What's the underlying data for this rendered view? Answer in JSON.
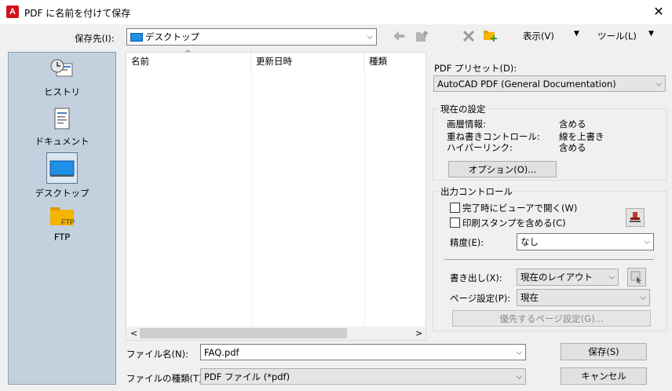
{
  "window": {
    "title": "PDF に名前を付けて保存",
    "app_icon_letter": "A"
  },
  "toolbar": {
    "save_in_label": "保存先(I):",
    "save_in_value": "デスクトップ",
    "view_menu": "表示(V)",
    "tools_menu": "ツール(L)"
  },
  "places": [
    {
      "label": "ヒストリ",
      "icon": "history-icon"
    },
    {
      "label": "ドキュメント",
      "icon": "documents-icon"
    },
    {
      "label": "デスクトップ",
      "icon": "desktop-icon"
    },
    {
      "label": "FTP",
      "icon": "ftp-folder-icon",
      "icon_text": "FTP"
    }
  ],
  "file_list": {
    "columns": [
      "名前",
      "更新日時",
      "種類"
    ]
  },
  "filename": {
    "label": "ファイル名(N):",
    "value": "FAQ.pdf"
  },
  "filetype": {
    "label": "ファイルの種類(T):",
    "value": "PDF ファイル (*pdf)"
  },
  "buttons": {
    "save": "保存(S)",
    "cancel": "キャンセル"
  },
  "pdf_preset": {
    "label": "PDF プリセット(D):",
    "value": "AutoCAD PDF (General Documentation)"
  },
  "current_settings": {
    "title": "現在の設定",
    "rows": [
      {
        "key": "画層情報:",
        "value": "含める"
      },
      {
        "key": "重ね書きコントロール:",
        "value": "線を上書き"
      },
      {
        "key": "ハイパーリンク:",
        "value": "含める"
      }
    ],
    "options_button": "オプション(O)..."
  },
  "output_control": {
    "title": "出力コントロール",
    "open_viewer_label": "完了時にビューアで開く(W)",
    "open_viewer_checked": false,
    "include_stamp_label": "印刷スタンプを含める(C)",
    "include_stamp_checked": false,
    "precision_label": "精度(E):",
    "precision_value": "なし",
    "export_label": "書き出し(X):",
    "export_value": "現在のレイアウト",
    "page_setup_label": "ページ設定(P):",
    "page_setup_value": "現在",
    "page_setup_override_button": "優先するページ設定(G)..."
  }
}
